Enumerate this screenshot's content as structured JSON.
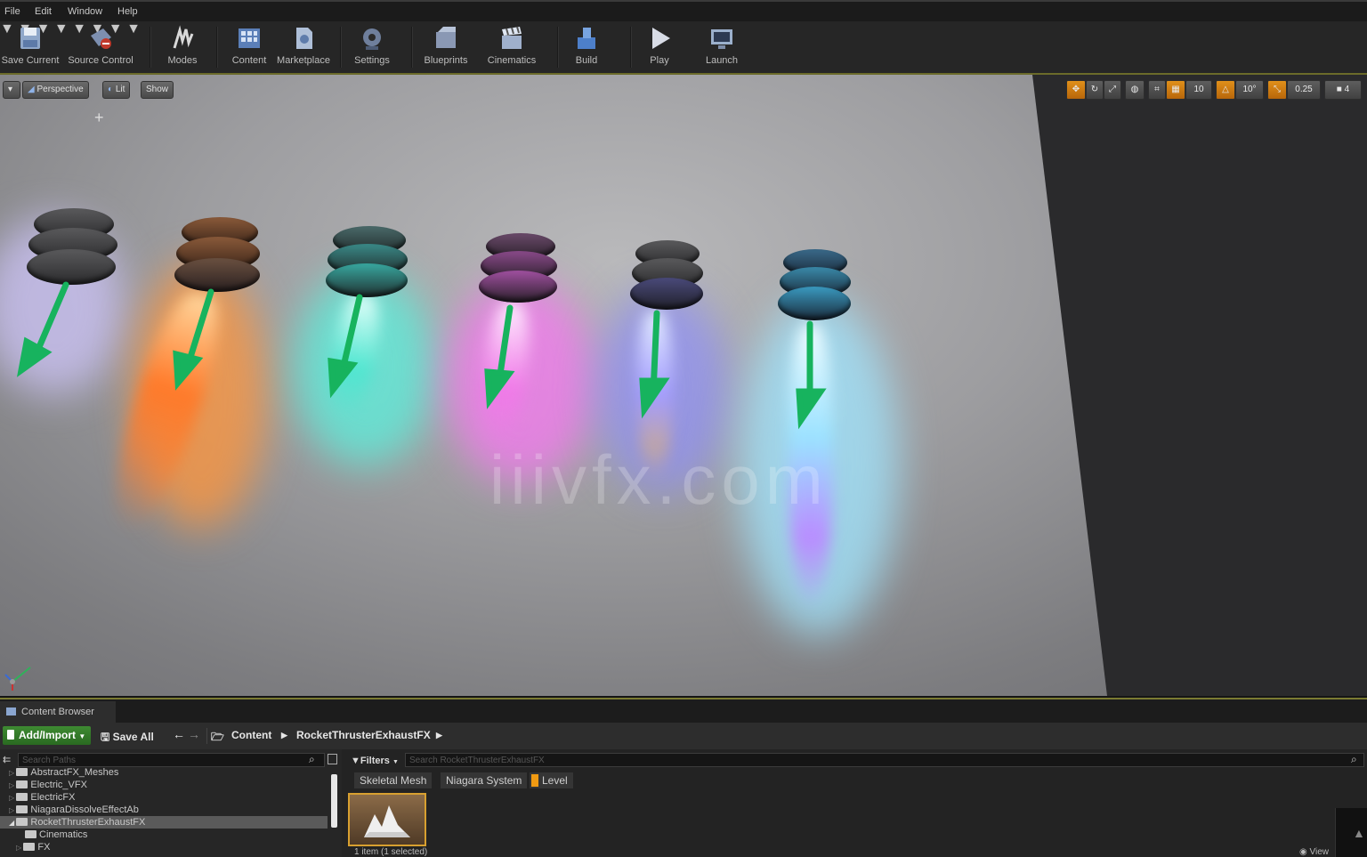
{
  "menu": [
    "File",
    "Edit",
    "Window",
    "Help"
  ],
  "toolbar": {
    "save_current": "Save Current",
    "source_control": "Source Control",
    "modes": "Modes",
    "content": "Content",
    "marketplace": "Marketplace",
    "settings": "Settings",
    "blueprints": "Blueprints",
    "cinematics": "Cinematics",
    "build": "Build",
    "play": "Play",
    "launch": "Launch"
  },
  "viewport": {
    "perspective": "Perspective",
    "lit": "Lit",
    "show": "Show",
    "grid_snap": "10",
    "rotation_snap": "10°",
    "scale_snap": "0.25",
    "camera_speed": "4",
    "watermark": "iiivfx.com"
  },
  "content_browser": {
    "tab_label": "Content Browser",
    "add_import": "Add/Import",
    "save_all": "Save All",
    "breadcrumb": [
      "Content",
      "RocketThrusterExhaustFX"
    ],
    "search_paths_placeholder": "Search Paths",
    "filters": "Filters",
    "search_assets_placeholder": "Search RocketThrusterExhaustFX",
    "filter_chips": [
      "Skeletal Mesh",
      "Niagara System",
      "Level"
    ],
    "folders": [
      "AbstractFX_Meshes",
      "Electric_VFX",
      "ElectricFX",
      "NiagaraDissolveEffectAb",
      "RocketThrusterExhaustFX",
      "Cinematics",
      "FX"
    ],
    "status": "1 item (1 selected)",
    "view_options": "View"
  },
  "colors": {
    "accent_green": "#2fa84a",
    "arrow_green": "#17b35e",
    "highlight_yellow": "#7b7b32",
    "snap_orange": "#d6820f"
  }
}
